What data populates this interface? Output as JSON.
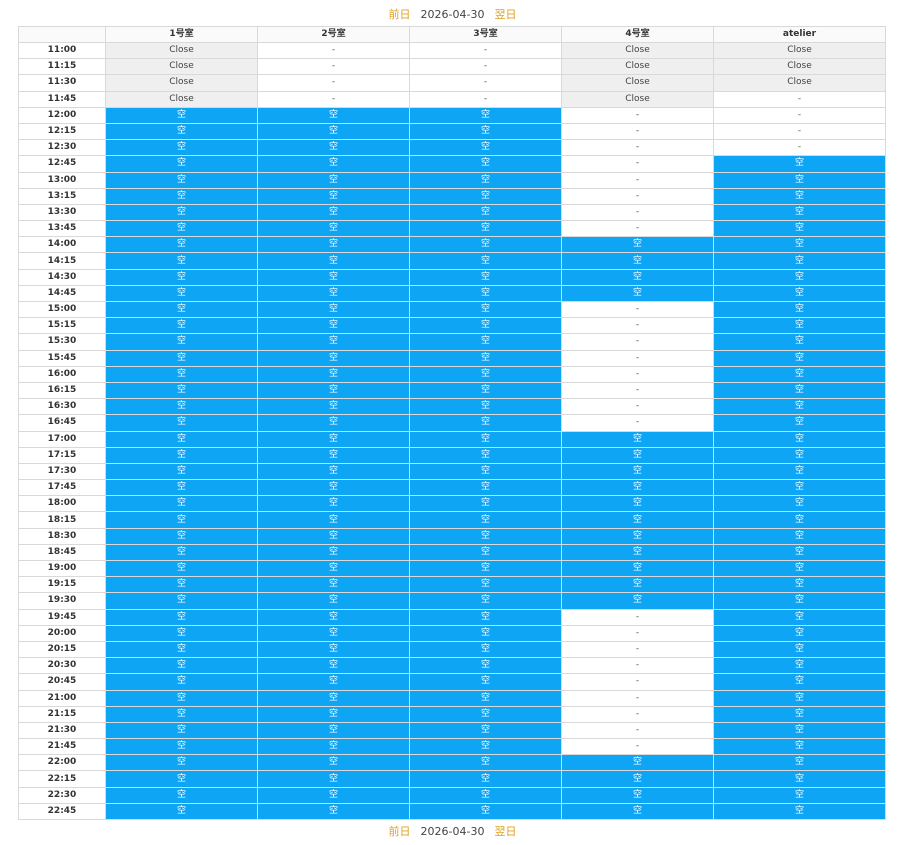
{
  "nav": {
    "prev": "前日",
    "date": "2026-04-30",
    "next": "翌日"
  },
  "labels": {
    "close": "Close",
    "none": "-",
    "empty": "空"
  },
  "colors": {
    "empty_bg": "#0ea5f4",
    "close_bg": "#efefef",
    "nav_link": "#e0a020"
  },
  "rooms": [
    "1号室",
    "2号室",
    "3号室",
    "4号室",
    "atelier"
  ],
  "times": [
    "11:00",
    "11:15",
    "11:30",
    "11:45",
    "12:00",
    "12:15",
    "12:30",
    "12:45",
    "13:00",
    "13:15",
    "13:30",
    "13:45",
    "14:00",
    "14:15",
    "14:30",
    "14:45",
    "15:00",
    "15:15",
    "15:30",
    "15:45",
    "16:00",
    "16:15",
    "16:30",
    "16:45",
    "17:00",
    "17:15",
    "17:30",
    "17:45",
    "18:00",
    "18:15",
    "18:30",
    "18:45",
    "19:00",
    "19:15",
    "19:30",
    "19:45",
    "20:00",
    "20:15",
    "20:30",
    "20:45",
    "21:00",
    "21:15",
    "21:30",
    "21:45",
    "22:00",
    "22:15",
    "22:30",
    "22:45"
  ],
  "grid": [
    "C--CC",
    "C--CC",
    "C--CC",
    "C--C-",
    "EEE--",
    "EEE--",
    "EEE--",
    "EEE-E",
    "EEE-E",
    "EEE-E",
    "EEE-E",
    "EEE-E",
    "EEEEE",
    "EEEEE",
    "EEEEE",
    "EEEEE",
    "EEE-E",
    "EEE-E",
    "EEE-E",
    "EEE-E",
    "EEE-E",
    "EEE-E",
    "EEE-E",
    "EEE-E",
    "EEEEE",
    "EEEEE",
    "EEEEE",
    "EEEEE",
    "EEEEE",
    "EEEEE",
    "EEEEE",
    "EEEEE",
    "EEEEE",
    "EEEEE",
    "EEEEE",
    "EEE-E",
    "EEE-E",
    "EEE-E",
    "EEE-E",
    "EEE-E",
    "EEE-E",
    "EEE-E",
    "EEE-E",
    "EEE-E",
    "EEEEE",
    "EEEEE",
    "EEEEE",
    "EEEEE"
  ]
}
